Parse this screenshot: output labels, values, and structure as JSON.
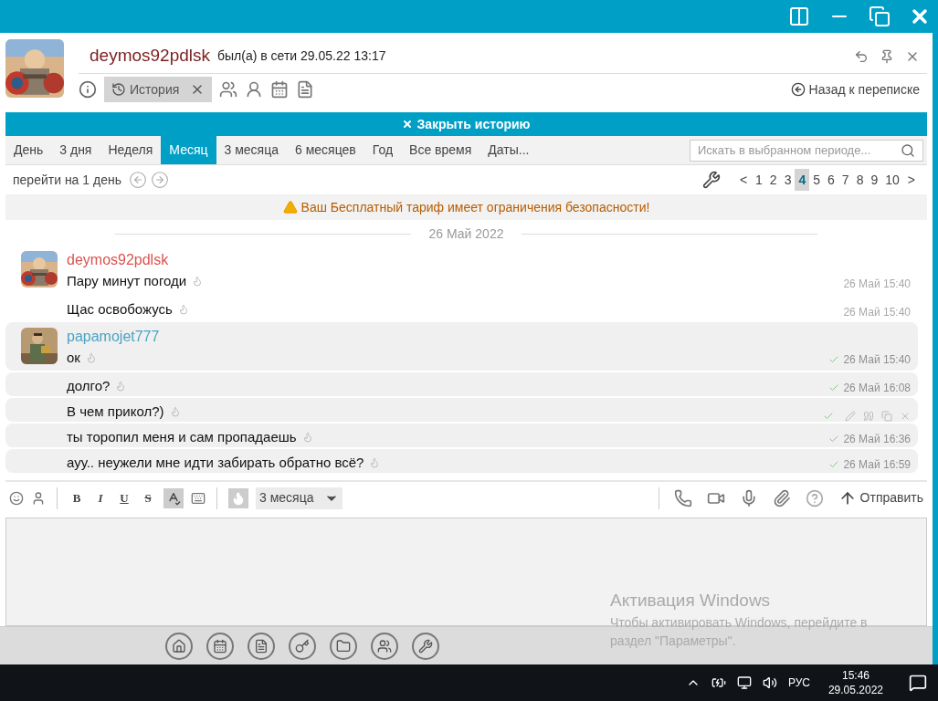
{
  "contact": {
    "name": "deymos92pdlsk",
    "status": "был(а) в сети 29.05.22 13:17"
  },
  "history_tab": {
    "label": "История",
    "selected": true
  },
  "back_link": "Назад к переписке",
  "close_history": "Закрыть историю",
  "periods": [
    {
      "label": "День",
      "selected": false
    },
    {
      "label": "3 дня",
      "selected": false
    },
    {
      "label": "Неделя",
      "selected": false
    },
    {
      "label": "Месяц",
      "selected": true
    },
    {
      "label": "3 месяца",
      "selected": false
    },
    {
      "label": "6 месяцев",
      "selected": false
    },
    {
      "label": "Год",
      "selected": false
    },
    {
      "label": "Все время",
      "selected": false
    },
    {
      "label": "Даты...",
      "selected": false
    }
  ],
  "search": {
    "placeholder": "Искать в выбранном периоде..."
  },
  "goto_label": "перейти на 1 день",
  "pager": {
    "prev": "<",
    "next": ">",
    "pages": [
      {
        "label": "1",
        "selected": false
      },
      {
        "label": "2",
        "selected": false
      },
      {
        "label": "3",
        "selected": false
      },
      {
        "label": "4",
        "selected": true
      },
      {
        "label": "5",
        "selected": false
      },
      {
        "label": "6",
        "selected": false
      },
      {
        "label": "7",
        "selected": false
      },
      {
        "label": "8",
        "selected": false
      },
      {
        "label": "9",
        "selected": false
      },
      {
        "label": "10",
        "selected": false
      }
    ]
  },
  "warning": "Ваш Бесплатный тариф имеет ограничения безопасности!",
  "date_divider": "26 Май 2022",
  "groups": [
    {
      "author": "deymos92pdlsk",
      "color": "#d9534f",
      "shaded": false,
      "messages": [
        {
          "text": "Пару минут погоди",
          "time": "26 Май 15:40",
          "read": false,
          "hovered": false
        },
        {
          "text": "Щас освобожусь",
          "time": "26 Май 15:40",
          "read": false,
          "hovered": false
        }
      ]
    },
    {
      "author": "papamojet777",
      "color": "#4ba3c3",
      "shaded": true,
      "messages": [
        {
          "text": "ок",
          "time": "26 Май 15:40",
          "read": true,
          "hovered": false
        },
        {
          "text": "долго?",
          "time": "26 Май 16:08",
          "read": true,
          "hovered": false
        },
        {
          "text": "В чем прикол?)",
          "read": true,
          "hovered": true
        },
        {
          "text": "ты торопил меня и сам пропадаешь",
          "time": "26 Май 16:36",
          "read": true,
          "hovered": false
        },
        {
          "text": "ауу.. неужели мне идти забирать обратно всё?",
          "time": "26 Май 16:59",
          "read": true,
          "hovered": false
        }
      ]
    }
  ],
  "composer": {
    "format": [
      {
        "label": "B",
        "kind": "bold"
      },
      {
        "label": "I",
        "kind": "italic"
      },
      {
        "label": "U",
        "kind": "underline"
      },
      {
        "label": "S",
        "kind": "strike"
      }
    ],
    "spellcheck": true,
    "burn": true,
    "burn_period": "3 месяца",
    "send": "Отправить"
  },
  "activation": {
    "title": "Активация Windows",
    "body": "Чтобы активировать Windows, перейдите в раздел \"Параметры\"."
  },
  "taskbar": {
    "language": "РУС",
    "time": "15:46",
    "date": "29.05.2022"
  }
}
